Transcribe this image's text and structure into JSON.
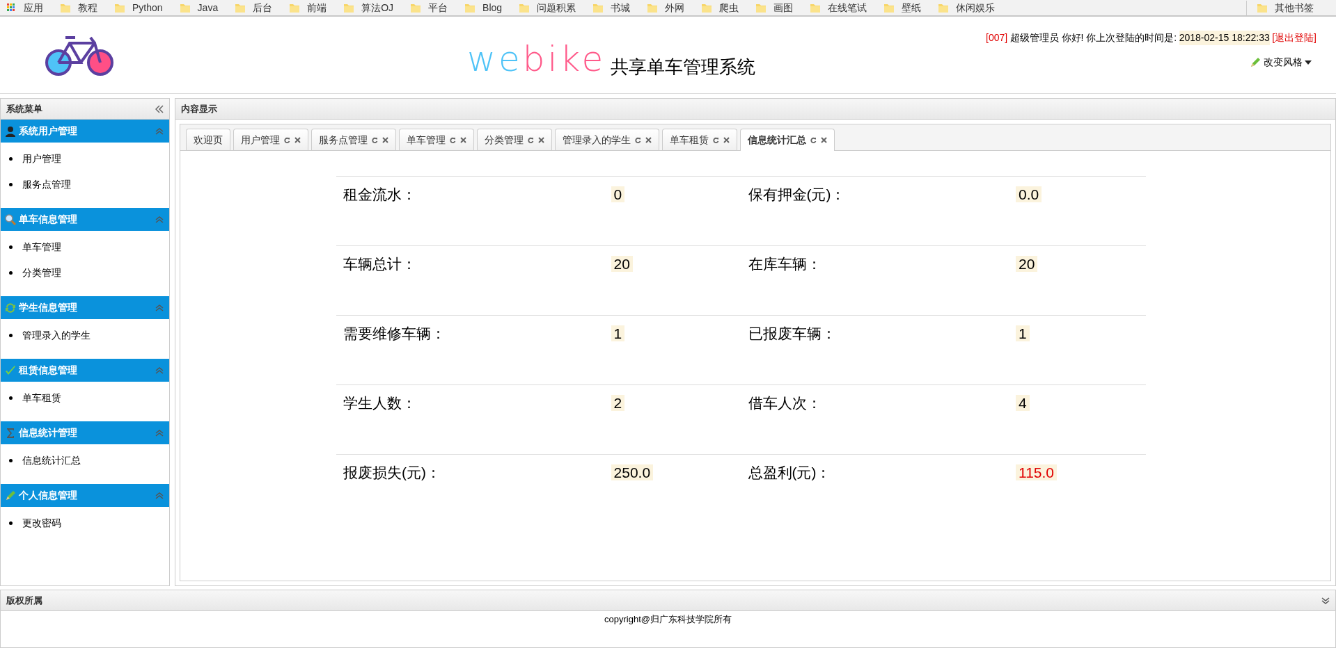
{
  "bookmarks": {
    "items": [
      {
        "label": "应用",
        "kind": "apps"
      },
      {
        "label": "教程",
        "kind": "folder"
      },
      {
        "label": "Python",
        "kind": "folder"
      },
      {
        "label": "Java",
        "kind": "folder"
      },
      {
        "label": "后台",
        "kind": "folder"
      },
      {
        "label": "前端",
        "kind": "folder"
      },
      {
        "label": "算法OJ",
        "kind": "folder"
      },
      {
        "label": "平台",
        "kind": "folder"
      },
      {
        "label": "Blog",
        "kind": "folder"
      },
      {
        "label": "问题积累",
        "kind": "folder"
      },
      {
        "label": "书城",
        "kind": "folder"
      },
      {
        "label": "外网",
        "kind": "folder"
      },
      {
        "label": "爬虫",
        "kind": "folder"
      },
      {
        "label": "画图",
        "kind": "folder"
      },
      {
        "label": "在线笔试",
        "kind": "folder"
      },
      {
        "label": "壁纸",
        "kind": "folder"
      },
      {
        "label": "休闲娱乐",
        "kind": "folder"
      }
    ],
    "other": "其他书签"
  },
  "header": {
    "logo_left": "we",
    "logo_mid": "bi",
    "logo_right": "ke",
    "title": "共享单车管理系统",
    "user_id": "[007]",
    "greeting": "超级管理员 你好! 你上次登陆的时间是:",
    "last_login": "2018-02-15 18:22:33",
    "logout": "[退出登陆]",
    "theme_menu": "改变风格"
  },
  "sidebar": {
    "title": "系统菜单",
    "sections": [
      {
        "title": "系统用户管理",
        "expanded": true,
        "items": [
          "用户管理",
          "服务点管理"
        ]
      },
      {
        "title": "单车信息管理",
        "expanded": true,
        "items": [
          "单车管理",
          "分类管理"
        ]
      },
      {
        "title": "学生信息管理",
        "expanded": true,
        "items": [
          "管理录入的学生"
        ]
      },
      {
        "title": "租赁信息管理",
        "expanded": true,
        "items": [
          "单车租赁"
        ]
      },
      {
        "title": "信息统计管理",
        "expanded": true,
        "items": [
          "信息统计汇总"
        ]
      },
      {
        "title": "个人信息管理",
        "expanded": true,
        "items": [
          "更改密码"
        ]
      }
    ]
  },
  "content": {
    "title": "内容显示",
    "tabs": [
      {
        "label": "欢迎页",
        "closable": false,
        "selected": false
      },
      {
        "label": "用户管理",
        "closable": true,
        "selected": false
      },
      {
        "label": "服务点管理",
        "closable": true,
        "selected": false
      },
      {
        "label": "单车管理",
        "closable": true,
        "selected": false
      },
      {
        "label": "分类管理",
        "closable": true,
        "selected": false
      },
      {
        "label": "管理录入的学生",
        "closable": true,
        "selected": false
      },
      {
        "label": "单车租赁",
        "closable": true,
        "selected": false
      },
      {
        "label": "信息统计汇总",
        "closable": true,
        "selected": true
      }
    ],
    "stats": [
      [
        {
          "label": "租金流水：",
          "value": "0",
          "emphasis": false
        },
        {
          "label": "保有押金(元)：",
          "value": "0.0",
          "emphasis": false
        }
      ],
      [
        {
          "label": "车辆总计：",
          "value": "20",
          "emphasis": false
        },
        {
          "label": "在库车辆：",
          "value": "20",
          "emphasis": false
        }
      ],
      [
        {
          "label": "需要维修车辆：",
          "value": "1",
          "emphasis": false
        },
        {
          "label": "已报废车辆：",
          "value": "1",
          "emphasis": false
        }
      ],
      [
        {
          "label": "学生人数：",
          "value": "2",
          "emphasis": false
        },
        {
          "label": "借车人次：",
          "value": "4",
          "emphasis": false
        }
      ],
      [
        {
          "label": "报废损失(元)：",
          "value": "250.0",
          "emphasis": false
        },
        {
          "label": "总盈利(元)：",
          "value": "115.0",
          "emphasis": true
        }
      ]
    ]
  },
  "footer": {
    "title": "版权所属",
    "expanded": false,
    "copyright": "copyright@归广东科技学院所有"
  }
}
